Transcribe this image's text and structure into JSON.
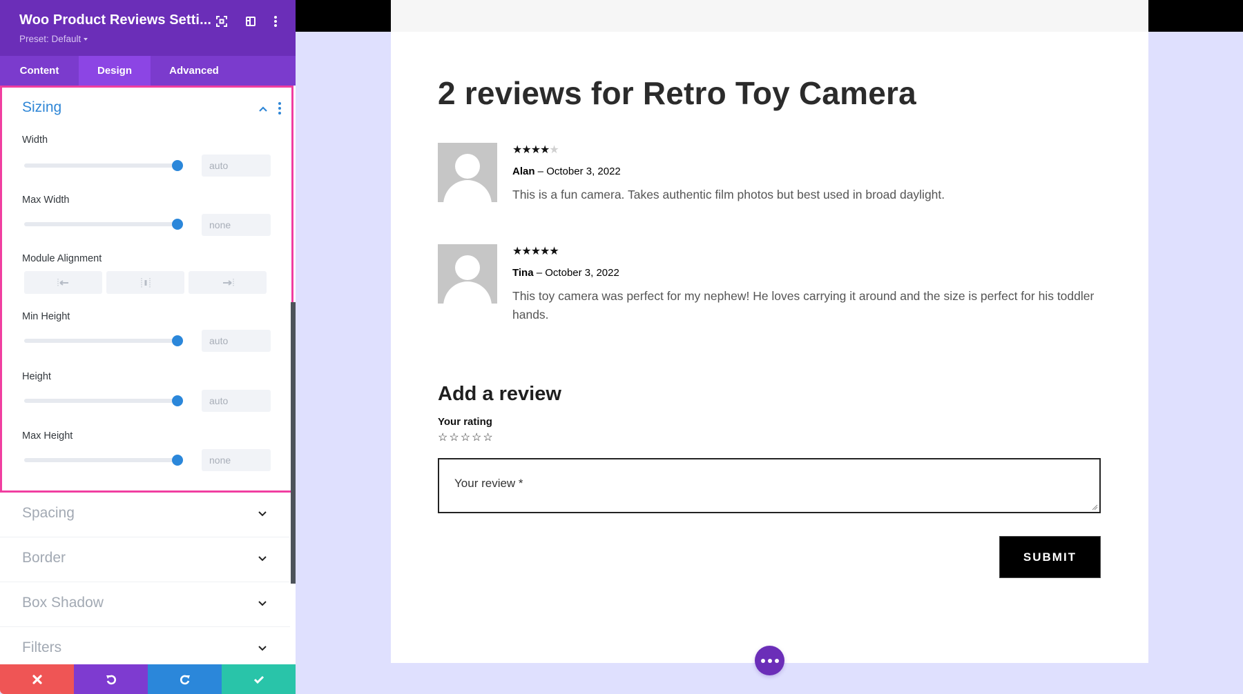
{
  "panel": {
    "title": "Woo Product Reviews Setti...",
    "preset": "Preset: Default",
    "header_icons": [
      "expand-icon",
      "split-view-icon",
      "more-options-icon"
    ],
    "tabs": [
      {
        "label": "Content",
        "active": false
      },
      {
        "label": "Design",
        "active": true
      },
      {
        "label": "Advanced",
        "active": false
      }
    ],
    "sizing": {
      "title": "Sizing",
      "fields": [
        {
          "label": "Width",
          "value": "auto",
          "slider_percent": 100
        },
        {
          "label": "Max Width",
          "value": "none",
          "slider_percent": 100
        },
        {
          "label": "Min Height",
          "value": "auto",
          "slider_percent": 100
        },
        {
          "label": "Height",
          "value": "auto",
          "slider_percent": 100
        },
        {
          "label": "Max Height",
          "value": "none",
          "slider_percent": 100
        }
      ],
      "module_alignment": {
        "label": "Module Alignment",
        "options": [
          "align-left-icon",
          "align-center-icon",
          "align-right-icon"
        ]
      }
    },
    "collapsed_sections": [
      "Spacing",
      "Border",
      "Box Shadow",
      "Filters"
    ],
    "bottom_bar": {
      "buttons": [
        {
          "name": "discard",
          "icon": "close-icon",
          "color": "#ef5555"
        },
        {
          "name": "undo",
          "icon": "undo-icon",
          "color": "#7e3bd0"
        },
        {
          "name": "redo",
          "icon": "redo-icon",
          "color": "#2b87da"
        },
        {
          "name": "save",
          "icon": "check-icon",
          "color": "#29c4a9"
        }
      ]
    },
    "colors": {
      "header": "#6b2eb8",
      "tabs": "#7b3bcd",
      "active_tab": "#8c45e4",
      "highlight_border": "#f03ea0",
      "accent_blue": "#2b87da"
    }
  },
  "preview": {
    "reviews_title": "2 reviews for Retro Toy Camera",
    "reviews": [
      {
        "author": "Alan",
        "separator": " – ",
        "date": "October 3, 2022",
        "rating": 4,
        "max_rating": 5,
        "text": "This is a fun camera. Takes authentic film photos but best used in broad daylight."
      },
      {
        "author": "Tina",
        "separator": " – ",
        "date": "October 3, 2022",
        "rating": 5,
        "max_rating": 5,
        "text": "This toy camera was perfect for my nephew! He loves carrying it around and the size is perfect for his toddler hands."
      }
    ],
    "form": {
      "title": "Add a review",
      "rating_label": "Your rating",
      "rating_stars": 5,
      "review_placeholder": "Your review *",
      "submit_label": "SUBMIT"
    },
    "fab_icon": "more-horizontal-icon"
  }
}
